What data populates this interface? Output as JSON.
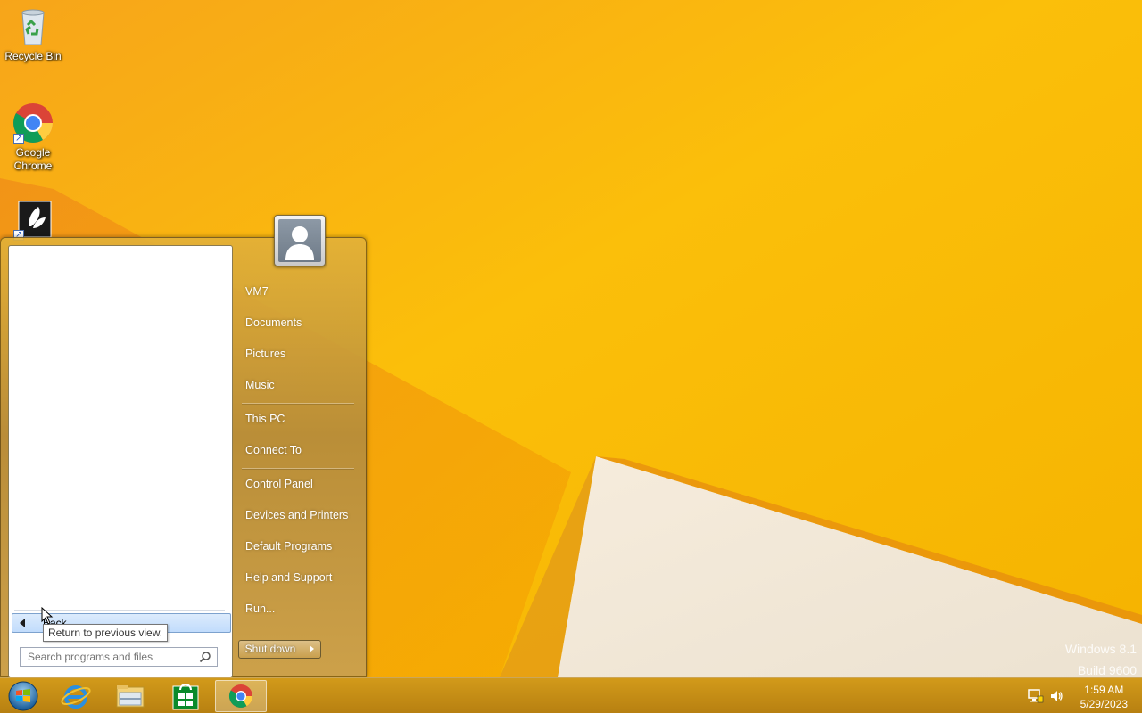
{
  "desktop": {
    "icons": [
      {
        "label": "Recycle Bin",
        "icon": "recycle-bin-icon"
      },
      {
        "label": "Google Chrome",
        "icon": "chrome-icon"
      },
      {
        "label": "",
        "icon": "app-shortcut-icon"
      }
    ],
    "watermark": {
      "line1": "Windows 8.1",
      "line2": "Build 9600"
    }
  },
  "start_menu": {
    "back_label": "Back",
    "tooltip": "Return to previous view.",
    "search_placeholder": "Search programs and files",
    "user_name": "VM7",
    "right_items": [
      "Documents",
      "Pictures",
      "Music",
      "This PC",
      "Connect To",
      "Control Panel",
      "Devices and Printers",
      "Default Programs",
      "Help and Support",
      "Run..."
    ],
    "shutdown_label": "Shut down"
  },
  "taskbar": {
    "buttons": [
      {
        "name": "start-button",
        "icon": "windows-orb-icon"
      },
      {
        "name": "internet-explorer",
        "icon": "ie-icon"
      },
      {
        "name": "file-explorer",
        "icon": "folder-icon"
      },
      {
        "name": "store",
        "icon": "store-icon"
      },
      {
        "name": "google-chrome",
        "icon": "chrome-icon",
        "active": true
      }
    ],
    "tray": {
      "time": "1:59 AM",
      "date": "5/29/2023"
    }
  },
  "colors": {
    "wallpaper": "#f5b800",
    "accent": "#d29a1a"
  }
}
